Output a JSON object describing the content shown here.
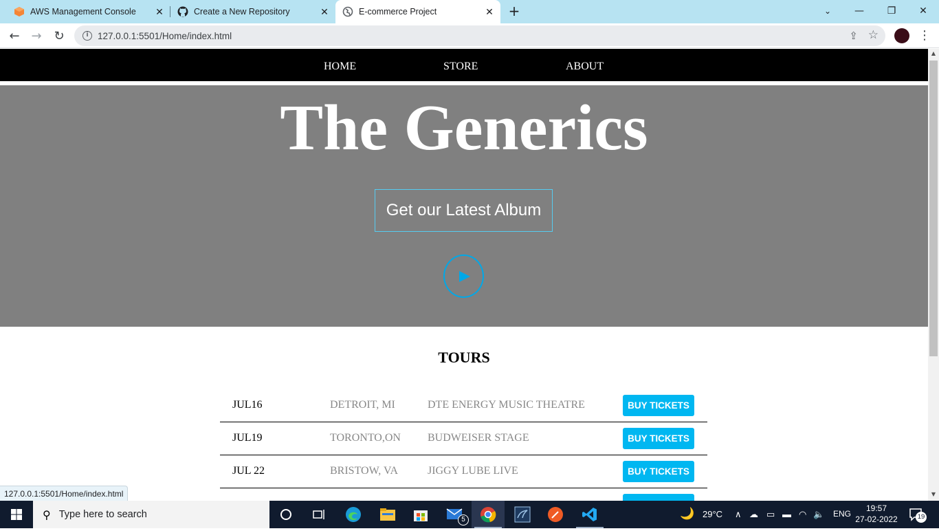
{
  "browser": {
    "tabs": [
      {
        "title": "AWS Management Console",
        "icon": "aws-icon",
        "active": false
      },
      {
        "title": "Create a New Repository",
        "icon": "github-icon",
        "active": false
      },
      {
        "title": "E-commerce Project",
        "icon": "globe-icon",
        "active": true
      }
    ],
    "address": "127.0.0.1:5501/Home/index.html",
    "status_url": "127.0.0.1:5501/Home/index.html"
  },
  "site": {
    "nav": [
      "HOME",
      "STORE",
      "ABOUT"
    ],
    "hero_title": "The Generics",
    "album_button": "Get our Latest Album",
    "tours_title": "TOURS",
    "tours": [
      {
        "date": "JUL16",
        "city": "DETROIT, MI",
        "venue": "DTE ENERGY MUSIC THEATRE",
        "button": "BUY TICKETS"
      },
      {
        "date": "JUL19",
        "city": "TORONTO,ON",
        "venue": "BUDWEISER STAGE",
        "button": "BUY TICKETS"
      },
      {
        "date": "JUL 22",
        "city": "BRISTOW, VA",
        "venue": "JIGGY LUBE LIVE",
        "button": "BUY TICKETS"
      }
    ],
    "colors": {
      "accent": "#00b7f1",
      "hero_bg": "#808080",
      "nav_bg": "#000000"
    }
  },
  "taskbar": {
    "search_placeholder": "Type here to search",
    "mail_badge": "5",
    "weather": "29°C",
    "language": "ENG",
    "time": "19:57",
    "date": "27-02-2022",
    "notifications": "19"
  }
}
